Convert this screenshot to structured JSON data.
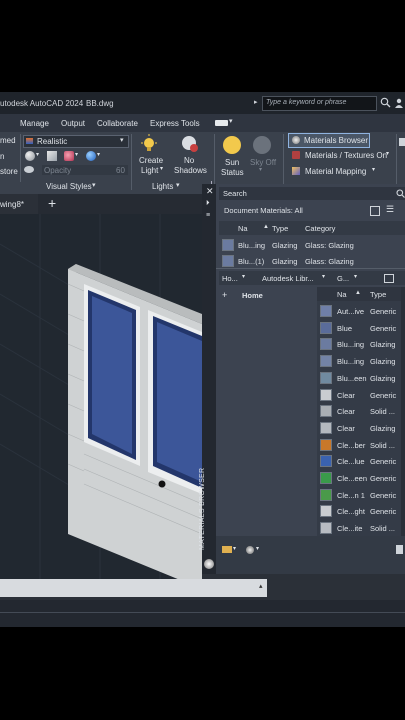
{
  "window": {
    "title": "utodesk AutoCAD 2024",
    "file": "BB.dwg",
    "search_placeholder": "Type a keyword or phrase"
  },
  "ribbon_tabs": [
    "Manage",
    "Output",
    "Collaborate",
    "Express Tools"
  ],
  "ribbon": {
    "left_partial": [
      "med",
      "n",
      "store"
    ],
    "visual_style_value": "Realistic",
    "opacity_label": "Opacity",
    "opacity_value": "60",
    "panel_visual_styles": "Visual Styles",
    "create_light": [
      "Create",
      "Light"
    ],
    "no_shadows": [
      "No",
      "Shadows"
    ],
    "panel_lights": "Lights",
    "sun_status": [
      "Sun",
      "Status"
    ],
    "sky_off": "Sky Off",
    "materials_browser": "Materials Browser",
    "materials_textures": "Materials / Textures On",
    "material_mapping": "Material Mapping"
  },
  "doc_tab": {
    "label": "wing8*",
    "plus": "+"
  },
  "palette": {
    "vertical_title": "MATERIALS BROWSER",
    "search_placeholder": "Search",
    "doc_materials_label": "Document Materials: All",
    "doc_headers": {
      "name": "Na",
      "type": "Type",
      "category": "Category"
    },
    "doc_rows": [
      {
        "name": "Blu...ing",
        "type": "Glazing",
        "category": "Glass: Glazing"
      },
      {
        "name": "Blu...(1)",
        "type": "Glazing",
        "category": "Glass: Glazing"
      }
    ],
    "lib_toolbar": {
      "home": "Ho...",
      "library": "Autodesk Libr...",
      "group": "G..."
    },
    "tree_home": "Home",
    "lib_headers": {
      "name": "Na",
      "type": "Type"
    },
    "lib_rows": [
      {
        "name": "Aut...ive",
        "type": "Generic",
        "color": "#6f7fa8"
      },
      {
        "name": "Blue",
        "type": "Generic",
        "color": "#5a6c9a"
      },
      {
        "name": "Blu...ing",
        "type": "Glazing",
        "color": "#6b7ba0"
      },
      {
        "name": "Blu...ing",
        "type": "Glazing",
        "color": "#7383a6"
      },
      {
        "name": "Blu...een",
        "type": "Glazing",
        "color": "#708aa0"
      },
      {
        "name": "Clear",
        "type": "Generic",
        "color": "#c9ccd0"
      },
      {
        "name": "Clear",
        "type": "Solid ...",
        "color": "#a9aeb4"
      },
      {
        "name": "Clear",
        "type": "Glazing",
        "color": "#b4b9bf"
      },
      {
        "name": "Cle...ber",
        "type": "Solid ...",
        "color": "#c8782a"
      },
      {
        "name": "Cle...lue",
        "type": "Generic",
        "color": "#3a62b0"
      },
      {
        "name": "Cle...een",
        "type": "Generic",
        "color": "#3a9a4a"
      },
      {
        "name": "Cle...n 1",
        "type": "Generic",
        "color": "#4a9a4a"
      },
      {
        "name": "Cle...ght",
        "type": "Generic",
        "color": "#c9ccd0"
      },
      {
        "name": "Cle...ite",
        "type": "Solid ...",
        "color": "#b8bcc2"
      }
    ]
  }
}
